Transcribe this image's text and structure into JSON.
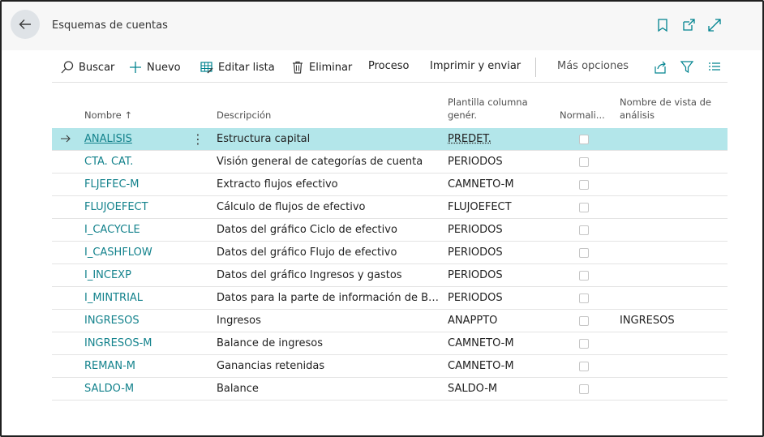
{
  "header": {
    "title": "Esquemas de cuentas"
  },
  "toolbar": {
    "search_label": "Buscar",
    "new_label": "Nuevo",
    "edit_list_label": "Editar lista",
    "delete_label": "Eliminar",
    "process_label": "Proceso",
    "print_send_label": "Imprimir y enviar",
    "more_options_label": "Más opciones"
  },
  "columns": {
    "name": "Nombre",
    "sort_indicator": "↑",
    "description": "Descripción",
    "template_line1": "Plantilla columna",
    "template_line2": "genér.",
    "normalized": "Normali...",
    "view_line1": "Nombre de vista de",
    "view_line2": "análisis"
  },
  "rows": [
    {
      "name": "ANALISIS",
      "description": "Estructura capital",
      "template": "PREDET.",
      "view": ""
    },
    {
      "name": "CTA. CAT.",
      "description": "Visión general de categorías de cuenta",
      "template": "PERIODOS",
      "view": ""
    },
    {
      "name": "FLJEFEC-M",
      "description": "Extracto flujos efectivo",
      "template": "CAMNETO-M",
      "view": ""
    },
    {
      "name": "FLUJOEFECT",
      "description": "Cálculo de flujos de efectivo",
      "template": "FLUJOEFECT",
      "view": ""
    },
    {
      "name": "I_CACYCLE",
      "description": "Datos del gráfico Ciclo de efectivo",
      "template": "PERIODOS",
      "view": ""
    },
    {
      "name": "I_CASHFLOW",
      "description": "Datos del gráfico Flujo de efectivo",
      "template": "PERIODOS",
      "view": ""
    },
    {
      "name": "I_INCEXP",
      "description": "Datos del gráfico Ingresos y gastos",
      "template": "PERIODOS",
      "view": ""
    },
    {
      "name": "I_MINTRIAL",
      "description": "Datos para la parte de información de Bala...",
      "template": "PERIODOS",
      "view": ""
    },
    {
      "name": "INGRESOS",
      "description": "Ingresos",
      "template": "ANAPPTO",
      "view": "INGRESOS"
    },
    {
      "name": "INGRESOS-M",
      "description": "Balance de ingresos",
      "template": "CAMNETO-M",
      "view": ""
    },
    {
      "name": "REMAN-M",
      "description": "Ganancias retenidas",
      "template": "CAMNETO-M",
      "view": ""
    },
    {
      "name": "SALDO-M",
      "description": "Balance",
      "template": "SALDO-M",
      "view": ""
    }
  ],
  "colors": {
    "link": "#13828c",
    "selected_row": "#b3e6ea",
    "accent": "#00838f"
  }
}
